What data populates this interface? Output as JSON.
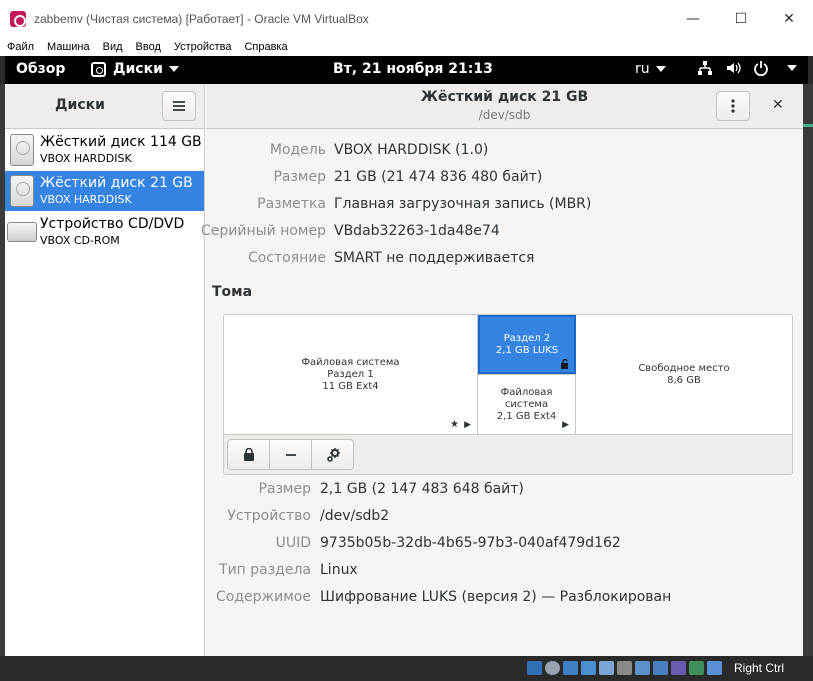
{
  "window": {
    "title": "zabbemv (Чистая система) [Работает] - Oracle VM VirtualBox",
    "controls": [
      "—",
      "☐",
      "✕"
    ]
  },
  "menubar": [
    "Файл",
    "Машина",
    "Вид",
    "Ввод",
    "Устройства",
    "Справка"
  ],
  "topbar": {
    "overview": "Обзор",
    "apps_label": "Диски",
    "clock": "Вт, 21 ноября  21:13",
    "lang": "ru",
    "icons": [
      "network-icon",
      "volume-icon",
      "power-icon"
    ]
  },
  "sidebar": {
    "title": "Диски",
    "disks": [
      {
        "name": "Жёсткий диск 114 GB",
        "model": "VBOX HARDDISK",
        "selected": false,
        "icon": "hard-disk-icon"
      },
      {
        "name": "Жёсткий диск 21 GB",
        "model": "VBOX HARDDISK",
        "selected": true,
        "icon": "hard-disk-icon"
      },
      {
        "name": "Устройство CD/DVD",
        "model": "VBOX CD-ROM",
        "selected": false,
        "icon": "optical-drive-icon"
      }
    ]
  },
  "header": {
    "title": "Жёсткий диск 21 GB",
    "subtitle": "/dev/sdb"
  },
  "drive_props": [
    {
      "key": "Модель",
      "value": "VBOX HARDDISK (1.0)"
    },
    {
      "key": "Размер",
      "value": "21 GB (21 474 836 480 байт)"
    },
    {
      "key": "Разметка",
      "value": "Главная загрузочная запись (MBR)"
    },
    {
      "key": "Серийный номер",
      "value": "VBdab32263-1da48e74"
    },
    {
      "key": "Состояние",
      "value": "SMART не поддерживается"
    }
  ],
  "volumes": {
    "title": "Тома",
    "partition1": [
      "Файловая система",
      "Раздел 1",
      "11 GB Ext4"
    ],
    "partition2": [
      "Раздел 2",
      "2,1 GB LUKS"
    ],
    "partition2_fs": [
      "Файловая система",
      "2,1 GB Ext4"
    ],
    "free": [
      "Свободное место",
      "8,6 GB"
    ],
    "tool_buttons": [
      "lock-icon",
      "minus-icon",
      "gears-icon"
    ]
  },
  "volume_props": [
    {
      "key": "Размер",
      "value": "2,1 GB (2 147 483 648 байт)"
    },
    {
      "key": "Устройство",
      "value": "/dev/sdb2"
    },
    {
      "key": "UUID",
      "value": "9735b05b-32db-4b65-97b3-040af479d162"
    },
    {
      "key": "Тип раздела",
      "value": "Linux"
    },
    {
      "key": "Содержимое",
      "value": "Шифрование LUKS (версия 2) — Разблокирован"
    }
  ],
  "statusbar": {
    "host_key": "Right Ctrl"
  },
  "colors": {
    "selection": "#3584e4",
    "topbar": "#000000"
  }
}
